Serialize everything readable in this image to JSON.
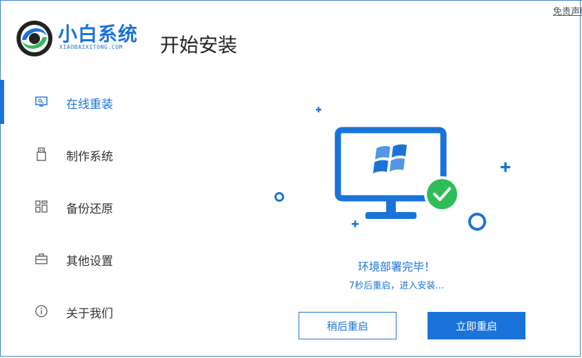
{
  "header": {
    "brand_name": "小白系统",
    "brand_sub": "XIAOBAIXITONG.COM",
    "page_title": "开始安装",
    "disclaimer": "免责声明"
  },
  "sidebar": {
    "items": [
      {
        "label": "在线重装",
        "icon": "monitor-icon",
        "active": true
      },
      {
        "label": "制作系统",
        "icon": "usb-drive-icon",
        "active": false
      },
      {
        "label": "备份还原",
        "icon": "grid-icon",
        "active": false
      },
      {
        "label": "其他设置",
        "icon": "briefcase-icon",
        "active": false
      },
      {
        "label": "关于我们",
        "icon": "info-icon",
        "active": false
      }
    ]
  },
  "main": {
    "status_title": "环境部署完毕！",
    "status_sub": "7秒后重启，进入安装...",
    "later_button": "稍后重启",
    "now_button": "立即重启"
  },
  "colors": {
    "accent": "#1a73d9",
    "success": "#2ebd59"
  }
}
